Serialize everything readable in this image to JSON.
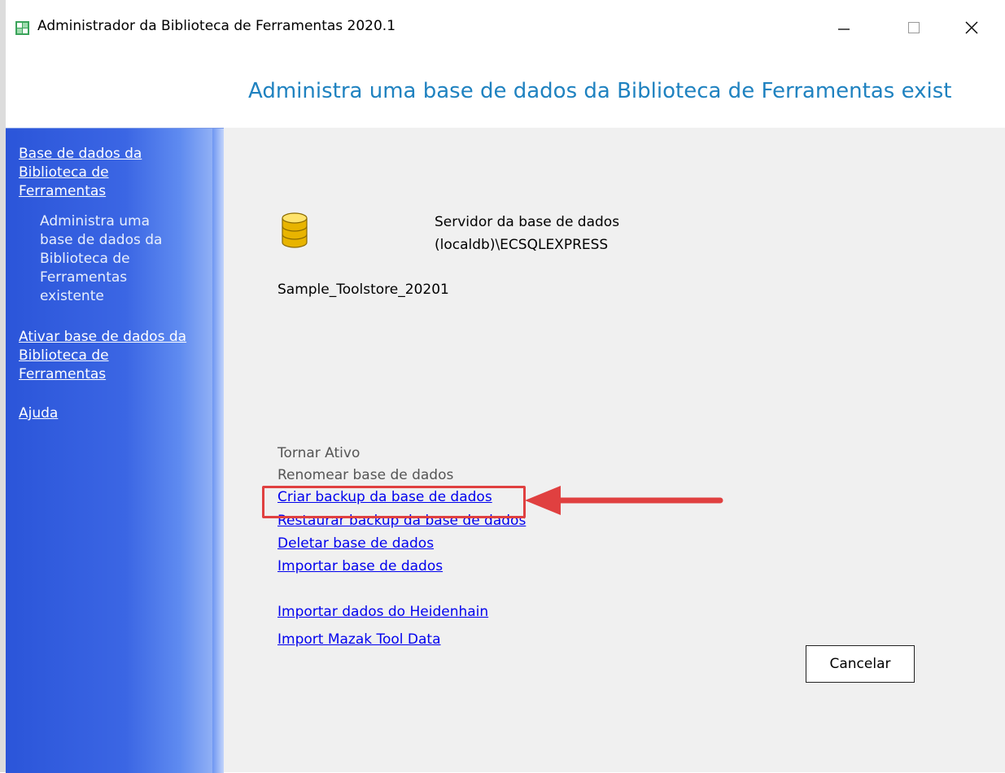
{
  "window": {
    "title": "Administrador da Biblioteca de Ferramentas 2020.1",
    "icons": {
      "app": "app-grid-icon",
      "minimize": "minimize-icon",
      "maximize": "maximize-icon",
      "close": "close-icon"
    }
  },
  "header": {
    "title": "Administra uma base de dados da Biblioteca de Ferramentas exist"
  },
  "sidebar": {
    "items": [
      {
        "label": "Base de dados da Biblioteca de Ferramentas",
        "description": "Administra uma base de dados da Biblioteca de Ferramentas existente"
      },
      {
        "label": "Ativar base de dados da Biblioteca de Ferramentas"
      },
      {
        "label": "Ajuda"
      }
    ]
  },
  "main": {
    "db_icon": "database-icon",
    "server_label": "Servidor da base de dados",
    "server_value": "(localdb)\\ECSQLEXPRESS",
    "database_name": "Sample_Toolstore_20201",
    "actions": [
      {
        "label": "Tornar Ativo",
        "enabled": false
      },
      {
        "label": "Renomear base de dados",
        "enabled": false
      },
      {
        "label": "Criar backup da base de dados",
        "enabled": true,
        "highlighted": true
      },
      {
        "label": "Restaurar backup da base de dados",
        "enabled": true
      },
      {
        "label": "Deletar base de dados",
        "enabled": true
      },
      {
        "label": "Importar base de dados",
        "enabled": true
      },
      {
        "label": "Importar dados do Heidenhain",
        "enabled": true
      },
      {
        "label": "Import Mazak Tool Data",
        "enabled": true
      }
    ],
    "cancel_label": "Cancelar"
  },
  "colors": {
    "header_title": "#1f82c0",
    "sidebar": "#3b66e4",
    "link": "#0000ee",
    "highlight": "#e04040"
  }
}
